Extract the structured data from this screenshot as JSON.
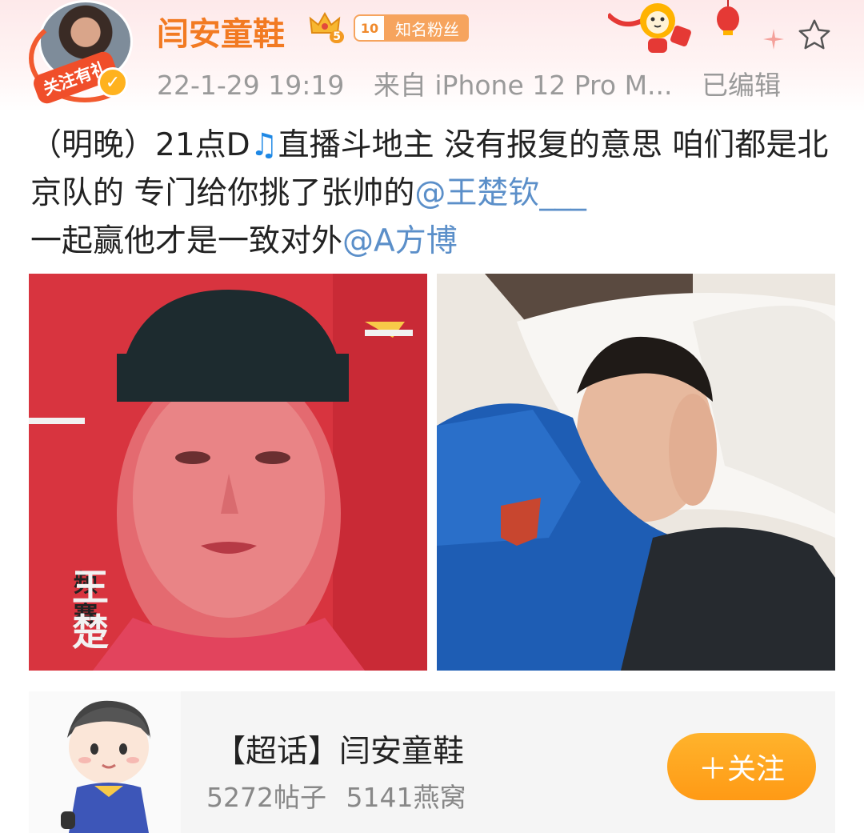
{
  "header": {
    "username": "闫安童鞋",
    "member_level": "5",
    "fan_level": "10",
    "fan_label": "知名粉丝",
    "follow_gift": "关注有礼",
    "timestamp": "22-1-29 19:19",
    "source": "来自 iPhone 12 Pro M...",
    "edited": "已编辑"
  },
  "post": {
    "text_part1": "（明晚）21点D",
    "music_icon": "♫",
    "text_part2": "直播斗地主  没有报复的意思 咱们都是北京队的 专门给你挑了张帅的",
    "mention1": "@王楚钦___",
    "text_part3": "一起赢他才是一致对外",
    "mention2": "@A方博"
  },
  "images": {
    "image1_caption_top": "频\n赛",
    "image1_caption_bottom": "王\n楚"
  },
  "topic": {
    "title": "【超话】闫安童鞋",
    "posts": "5272帖子",
    "members": "5141燕窝",
    "follow_label": "＋关注"
  },
  "colors": {
    "username": "#f27a22",
    "mention": "#5b8fc9",
    "follow_button": "#ff9f1c",
    "meta_text": "#9a9a9a"
  }
}
